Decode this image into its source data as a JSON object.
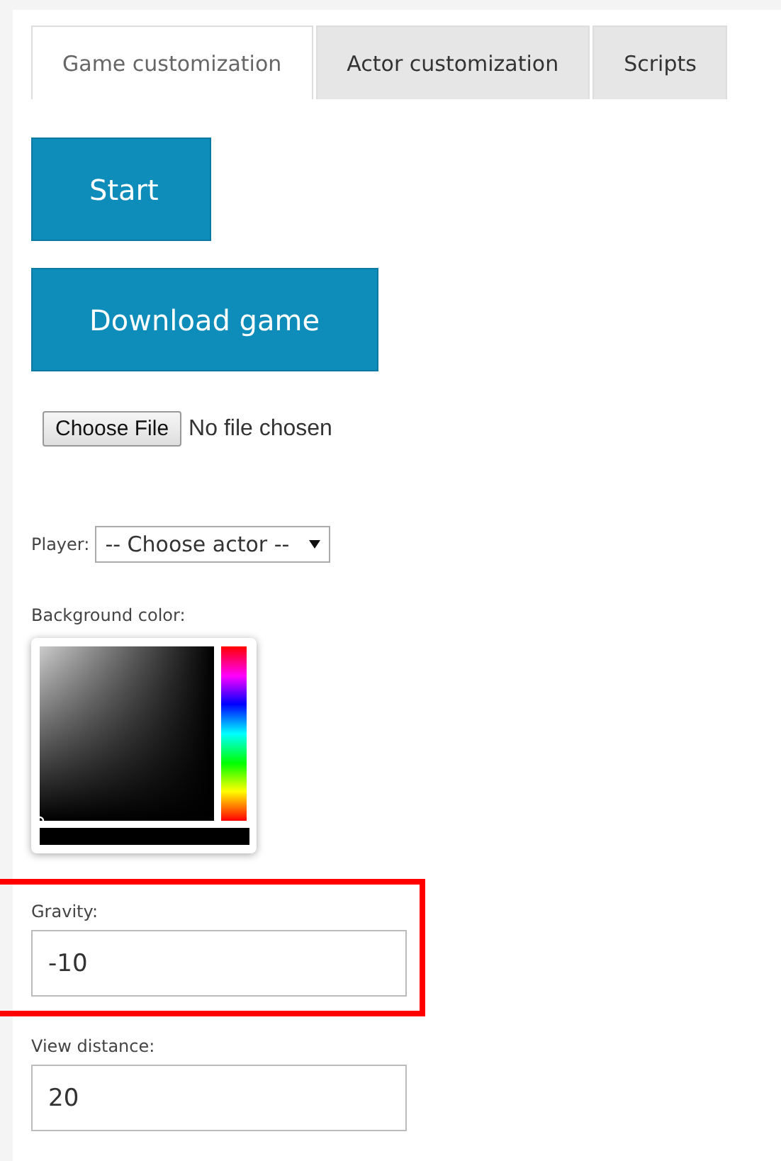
{
  "tabs": [
    {
      "label": "Game customization",
      "selected": true
    },
    {
      "label": "Actor customization",
      "selected": false
    },
    {
      "label": "Scripts",
      "selected": false
    }
  ],
  "buttons": [
    "Start",
    "Download game"
  ],
  "file_input": {
    "button": "Choose File",
    "status": "No file chosen"
  },
  "player": {
    "label": "Player:",
    "value": "-- Choose actor --"
  },
  "background_color": {
    "label": "Background color:",
    "hue_slider": {
      "level": 0
    }
  },
  "fields": [
    {
      "label": "Gravity:",
      "value": "-10",
      "highlighted": true
    },
    {
      "label": "View distance:",
      "value": "20",
      "highlighted": false
    }
  ]
}
